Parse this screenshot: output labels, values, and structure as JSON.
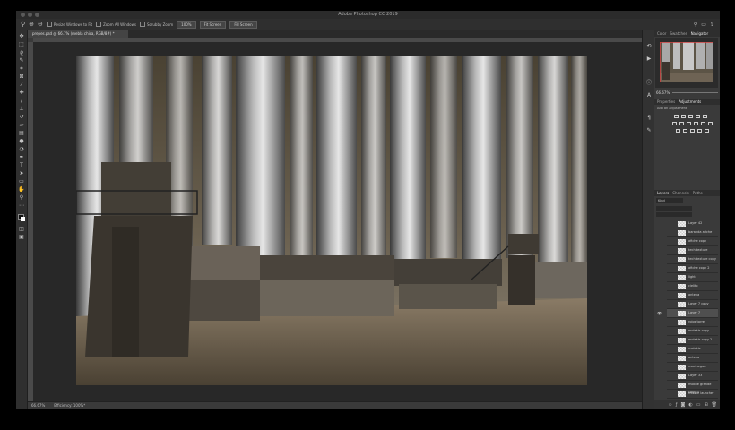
{
  "app": {
    "title": "Adobe Photoshop CC 2019"
  },
  "options_bar": {
    "resize_windows": "Resize Windows to Fit",
    "zoom_all_windows": "Zoom All Windows",
    "scrubby_zoom": "Scrubby Zoom",
    "zoom_pct_button": "100%",
    "fit_screen_button": "Fit Screen",
    "fill_screen_button": "Fill Screen"
  },
  "document": {
    "tab_label": "prepes.psd @ 66.7% (mebla chica, RGB/8#) *",
    "zoom": "66.67%",
    "efficiency": "Efficiency: 100%*"
  },
  "panels": {
    "top_tabs": [
      "Color",
      "Swatches",
      "Navigator"
    ],
    "navigator_zoom": "66.67%",
    "mid_tabs": [
      "Properties",
      "Adjustments"
    ],
    "add_adjustment": "Add an adjustment",
    "layer_tabs": [
      "Layers",
      "Channels",
      "Paths"
    ],
    "kind_filter": "Kind"
  },
  "layers": [
    "Layer 42",
    "baranda afiche",
    "afiche copy",
    "tech texture",
    "tech texture copy",
    "afiche copy 2",
    "light",
    "cielito",
    "antena",
    "Layer 7 copy",
    "Layer 7",
    "rojos torre",
    "molekis copy",
    "molekis copy 2",
    "molekis",
    "antena",
    "macinegun",
    "Layer 33",
    "mobile grande copy 3",
    "missile launcher copy",
    "cohete copy"
  ],
  "selected_layer_index": 10,
  "colors": {
    "accent": "#d04040",
    "panel_bg": "#3a3a3a",
    "ui_dark": "#2f2f2f"
  }
}
